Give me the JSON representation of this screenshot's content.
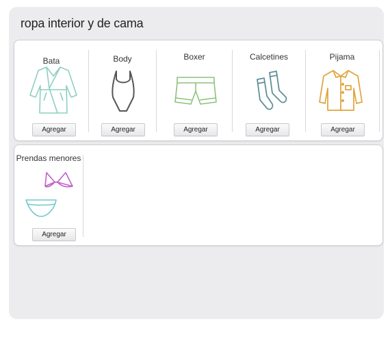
{
  "header": {
    "title": "ropa interior y de cama"
  },
  "groups": [
    {
      "items": [
        {
          "label": "Bata",
          "icon": "bathrobe-icon",
          "button": "Agregar",
          "color": "#8ccfc2"
        },
        {
          "label": "Body",
          "icon": "bodysuit-icon",
          "button": "Agregar",
          "color": "#555555"
        },
        {
          "label": "Boxer",
          "icon": "boxer-icon",
          "button": "Agregar",
          "color": "#8cc27a"
        },
        {
          "label": "Calcetines",
          "icon": "socks-icon",
          "button": "Agregar",
          "color": "#5f8f99"
        },
        {
          "label": "Pijama",
          "icon": "pajama-icon",
          "button": "Agregar",
          "color": "#e0a33a"
        }
      ]
    },
    {
      "items": [
        {
          "label": "Prendas menores",
          "icon": "underwear-icon",
          "button": "Agregar",
          "color": "#c25fc9"
        }
      ]
    }
  ]
}
